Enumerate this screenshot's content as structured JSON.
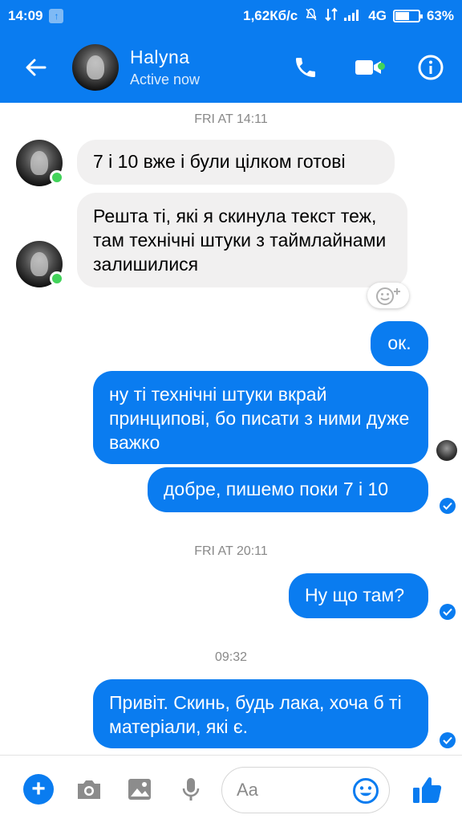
{
  "status": {
    "time": "14:09",
    "speed": "1,62Кб/с",
    "network": "4G",
    "battery": "63%",
    "battery_level": 0.63
  },
  "header": {
    "name": "Halyna",
    "subtitle": "Active now"
  },
  "messages": {
    "ts1": "FRI AT 14:11",
    "m1": "7 і 10 вже і були цілком готові",
    "m2": "Решта ті, які я скинула текст теж,  там технічні штуки з таймлайнами залишилися",
    "m3": "ок.",
    "m4": "ну ті технічні штуки вкрай принципові, бо писати з ними дуже важко",
    "m5": "добре, пишемо поки 7 і 10",
    "ts2": "FRI AT 20:11",
    "m6": "Ну що там?",
    "ts3": "09:32",
    "m7": "Привіт. Скинь, будь лака, хоча б ті матеріали, які є."
  },
  "composer": {
    "placeholder": "Aa"
  },
  "colors": {
    "accent": "#0a7cf0",
    "incoming_bubble": "#f1f0f0",
    "online": "#42d35a"
  }
}
